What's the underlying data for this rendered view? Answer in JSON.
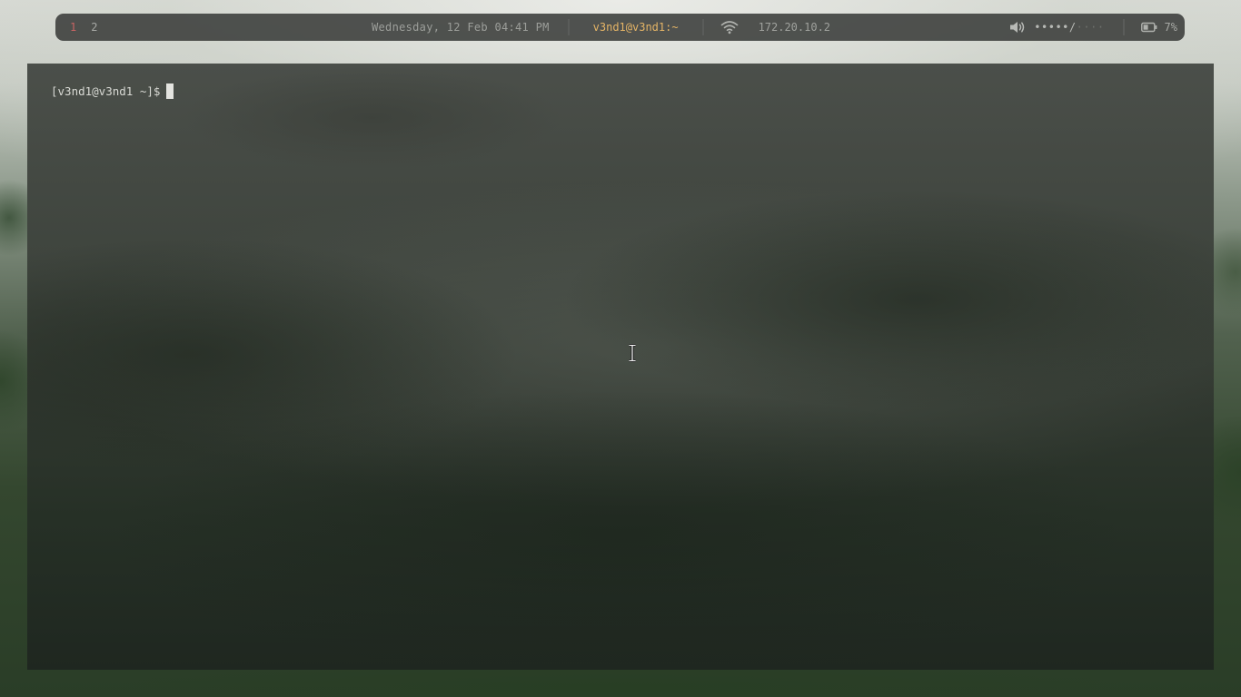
{
  "topbar": {
    "workspaces": [
      {
        "label": "1",
        "active": true
      },
      {
        "label": "2",
        "active": false
      }
    ],
    "clock": "Wednesday, 12 Feb 04:41 PM",
    "window_title": "v3nd1@v3nd1:~",
    "network": {
      "icon": "wifi-icon",
      "ip": "172.20.10.2"
    },
    "volume": {
      "icon": "speaker-icon",
      "level_bar_filled": "•••••",
      "level_bar_separator": "/",
      "level_bar_empty": "····"
    },
    "battery": {
      "icon": "battery-icon",
      "percent": "7%"
    }
  },
  "terminal": {
    "prompt": "[v3nd1@v3nd1 ~]$",
    "input": ""
  },
  "colors": {
    "active_workspace": "#c86464",
    "window_title": "#e5b566",
    "bar_background": "#3a3c3a"
  }
}
